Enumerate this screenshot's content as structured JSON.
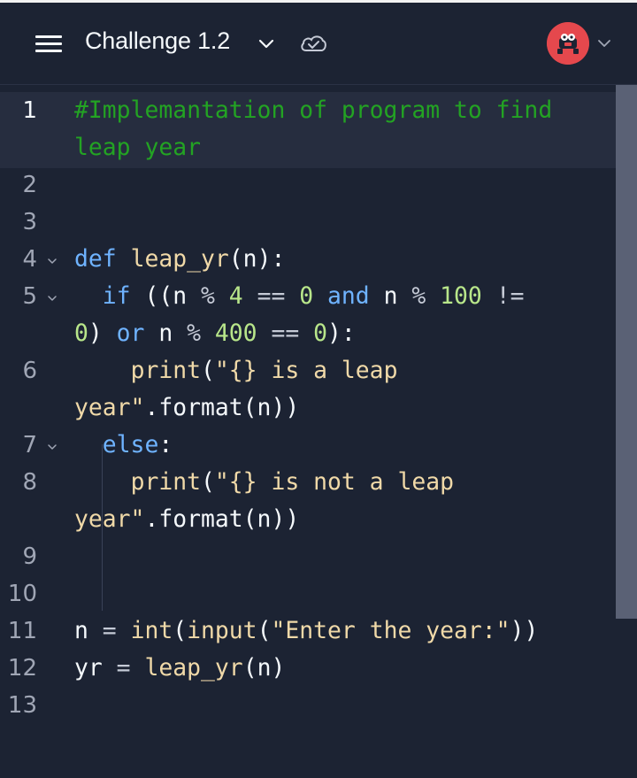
{
  "header": {
    "title": "Challenge 1.2",
    "menu_icon": "hamburger-icon",
    "title_dropdown_icon": "chevron-down-icon",
    "sync_icon": "cloud-check-icon",
    "avatar_icon": "user-avatar-icon",
    "avatar_dropdown_icon": "chevron-down-icon"
  },
  "editor": {
    "active_line": 1,
    "line_numbers": [
      "1",
      "2",
      "3",
      "4",
      "5",
      "6",
      "7",
      "8",
      "9",
      "10",
      "11",
      "12",
      "13"
    ],
    "code": {
      "l1a": "#Implemantation of program to find",
      "l1b": "leap year",
      "def_kw": "def",
      "fn_name": "leap_yr",
      "param_open": "(n):",
      "if_kw": "if",
      "if_a": "((n ",
      "mod1": "%",
      "num4": "4",
      "eq1": "==",
      "num0a": "0",
      "and_kw": "and",
      "n2": " n ",
      "mod2": "%",
      "num100": "100",
      "neq": "!=",
      "num0b": "0",
      "close1": ")",
      "or_kw": "or",
      "n3": " n ",
      "mod3": "%",
      "num400": "400",
      "eq2": "==",
      "num0c": "0",
      "close2": "):",
      "print1": "print",
      "p1_open": "(",
      "str1a": "\"{} is a leap",
      "str1b": "year\"",
      "fmt1": ".format(n))",
      "else_kw": "else",
      "colon": ":",
      "print2": "print",
      "p2_open": "(",
      "str2a": "\"{} is not a leap",
      "str2b": "year\"",
      "fmt2": ".format(n))",
      "n_assign": "n ",
      "eq_op": "=",
      "int_fn": "int",
      "paren_a": "(",
      "input_fn": "input",
      "paren_b": "(",
      "prompt_str": "\"Enter the year:\"",
      "paren_c": "))",
      "yr_assign": "yr ",
      "eq_op2": "=",
      "leap_call": "leap_yr",
      "call_args": "(n)"
    }
  },
  "colors": {
    "background": "#1c2333",
    "comment": "#23a323",
    "keyword": "#6fb3ff",
    "string": "#f0d9a8",
    "number": "#b8e68a",
    "avatar": "#e5484d"
  }
}
